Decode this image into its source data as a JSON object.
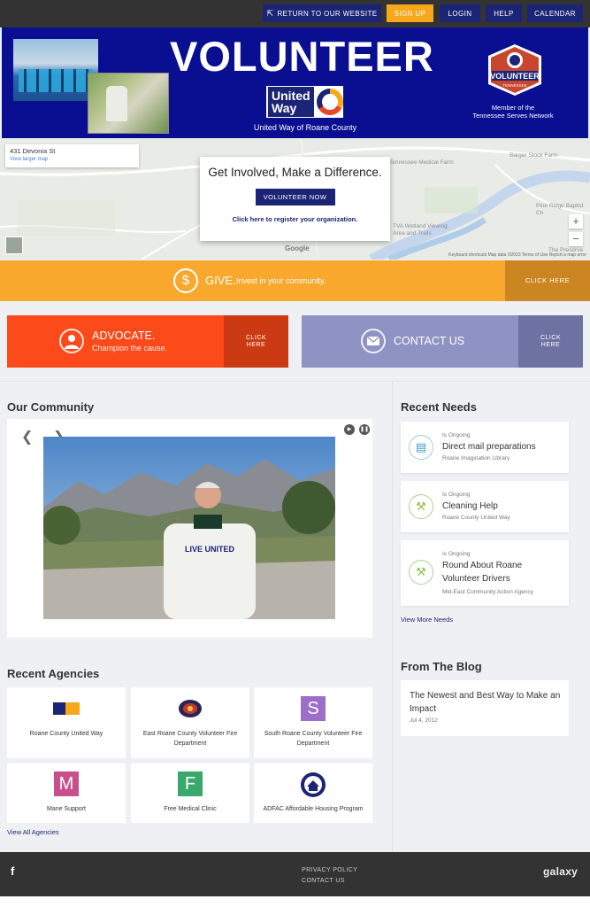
{
  "topbar": {
    "return_label": "Return to Our Website",
    "signup_label": "Sign Up",
    "login_label": "Login",
    "help_label": "Help",
    "calendar_label": "Calendar"
  },
  "banner": {
    "title": "VOLUNTEER",
    "uw_logo_line1": "United",
    "uw_logo_line2": "Way",
    "uw_caption": "United Way of Roane County",
    "badge_text": "VOLUNTEER",
    "badge_sub": "TENNESSEE",
    "member_line1": "Member of the",
    "member_line2": "Tennessee Serves Network"
  },
  "map": {
    "address": "431 Devonia St",
    "larger_map": "View larger map",
    "labels": [
      "Barger Stock Farm",
      "Tennessee Medical Farm",
      "Pine Ridge Baptist Ch",
      "TVA Wetland Viewing Area and Trails",
      "The Preserve"
    ],
    "footer_links": "Keyboard shortcuts   Map data ©2023   Terms of Use   Report a map error",
    "google": "Google"
  },
  "get_involved": {
    "heading": "Get Involved, Make a Difference.",
    "button": "VOLUNTEER NOW",
    "register_link": "Click here to register your organization."
  },
  "give": {
    "label": "GIVE.",
    "sub": "Invest in your community.",
    "button": "CLICK HERE"
  },
  "advocate": {
    "label": "ADVOCATE.",
    "sub": "Champion the cause.",
    "button_line1": "CLICK",
    "button_line2": "HERE"
  },
  "contact": {
    "label": "CONTACT US",
    "button_line1": "CLICK",
    "button_line2": "HERE"
  },
  "community": {
    "heading": "Our Community",
    "shirt_text": "LIVE UNITED"
  },
  "needs": {
    "heading": "Recent Needs",
    "items": [
      {
        "status": "Is Ongoing",
        "title": "Direct mail preparations",
        "org": "Roane Imagination Library",
        "icon": "clipboard-icon"
      },
      {
        "status": "Is Ongoing",
        "title": "Cleaning Help",
        "org": "Roane County United Way",
        "icon": "hammer-icon"
      },
      {
        "status": "Is Ongoing",
        "title": "Round About Roane Volunteer Drivers",
        "org": "Mid-East Community Action Agency",
        "icon": "hammer-icon"
      }
    ],
    "view_more": "View More Needs"
  },
  "agencies": {
    "heading": "Recent Agencies",
    "items": [
      {
        "name": "Roane County United Way",
        "logo": "united-way-logo"
      },
      {
        "name": "East Roane County Volunteer Fire Department",
        "logo": "fire-dept-logo"
      },
      {
        "name": "South Roane County Volunteer Fire Department",
        "letter": "S",
        "color": "#9b6fc9"
      },
      {
        "name": "Mane Support",
        "letter": "M",
        "color": "#c94f8c"
      },
      {
        "name": "Free Medical Clinic",
        "letter": "F",
        "color": "#3aa86a"
      },
      {
        "name": "ADFAC Affordable Housing Program",
        "logo": "adfac-logo"
      }
    ],
    "view_all": "View All Agencies"
  },
  "blog": {
    "heading": "From The Blog",
    "post_title": "The Newest and Best Way to Make an Impact",
    "post_date": "Jul 4, 2012"
  },
  "footer": {
    "privacy": "PRIVACY POLICY",
    "contact": "CONTACT US",
    "brand": "galaxy"
  },
  "colors": {
    "navy": "#1c2475",
    "orange": "#f9a82e",
    "advocate": "#fc4a1a",
    "contact": "#8e93c3"
  }
}
